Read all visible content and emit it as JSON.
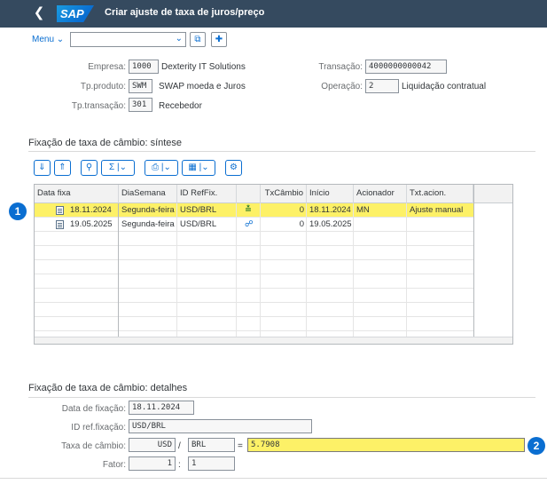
{
  "header": {
    "logo": "SAP",
    "title": "Criar ajuste de taxa de juros/preço"
  },
  "toolbar": {
    "menu_label": "Menu",
    "dropdown_value": ""
  },
  "form": {
    "empresa": {
      "label": "Empresa:",
      "code": "1000",
      "desc": "Dexterity IT Solutions"
    },
    "tp_produto": {
      "label": "Tp.produto:",
      "code": "SWM",
      "desc": "SWAP moeda e Juros"
    },
    "tp_transacao": {
      "label": "Tp.transação:",
      "code": "301",
      "desc": "Recebedor"
    },
    "transacao": {
      "label": "Transação:",
      "value": "4000000000042"
    },
    "operacao": {
      "label": "Operação:",
      "code": "2",
      "desc": "Liquidação contratual"
    }
  },
  "synopsis": {
    "title": "Fixação de taxa de câmbio: síntese",
    "columns": [
      "Data fixa",
      "DiaSemana",
      "ID RefFix.",
      "",
      "TxCâmbio",
      "Início",
      "Acionador",
      "Txt.acion."
    ],
    "rows": [
      {
        "data_fixa": "18.11.2024",
        "dia_semana": "Segunda-feira",
        "id_reffix": "USD/BRL",
        "tx_cambio": "0",
        "inicio": "18.11.2024",
        "acionador": "MN",
        "txt_acion": "Ajuste manual",
        "status_icon": "edit-icon"
      },
      {
        "data_fixa": "19.05.2025",
        "dia_semana": "Segunda-feira",
        "id_reffix": "USD/BRL",
        "tx_cambio": "0",
        "inicio": "19.05.2025",
        "acionador": "",
        "txt_acion": "",
        "status_icon": "unlock-icon"
      }
    ]
  },
  "details": {
    "title": "Fixação de taxa de câmbio: detalhes",
    "data_fixacao": {
      "label": "Data de fixação:",
      "value": "18.11.2024"
    },
    "id_ref_fixacao": {
      "label": "ID ref.fixação:",
      "value": "USD/BRL"
    },
    "taxa_cambio": {
      "label": "Taxa de câmbio:",
      "from": "USD",
      "sep": "/",
      "to": "BRL",
      "eq": "=",
      "value": "5.7908"
    },
    "fator": {
      "label": "Fator:",
      "from": "1",
      "sep": ":",
      "to": "1"
    }
  },
  "badges": {
    "one": "1",
    "two": "2"
  },
  "colors": {
    "shell": "#354a5f",
    "accent": "#0a6ed1",
    "highlight": "#fdf167"
  }
}
